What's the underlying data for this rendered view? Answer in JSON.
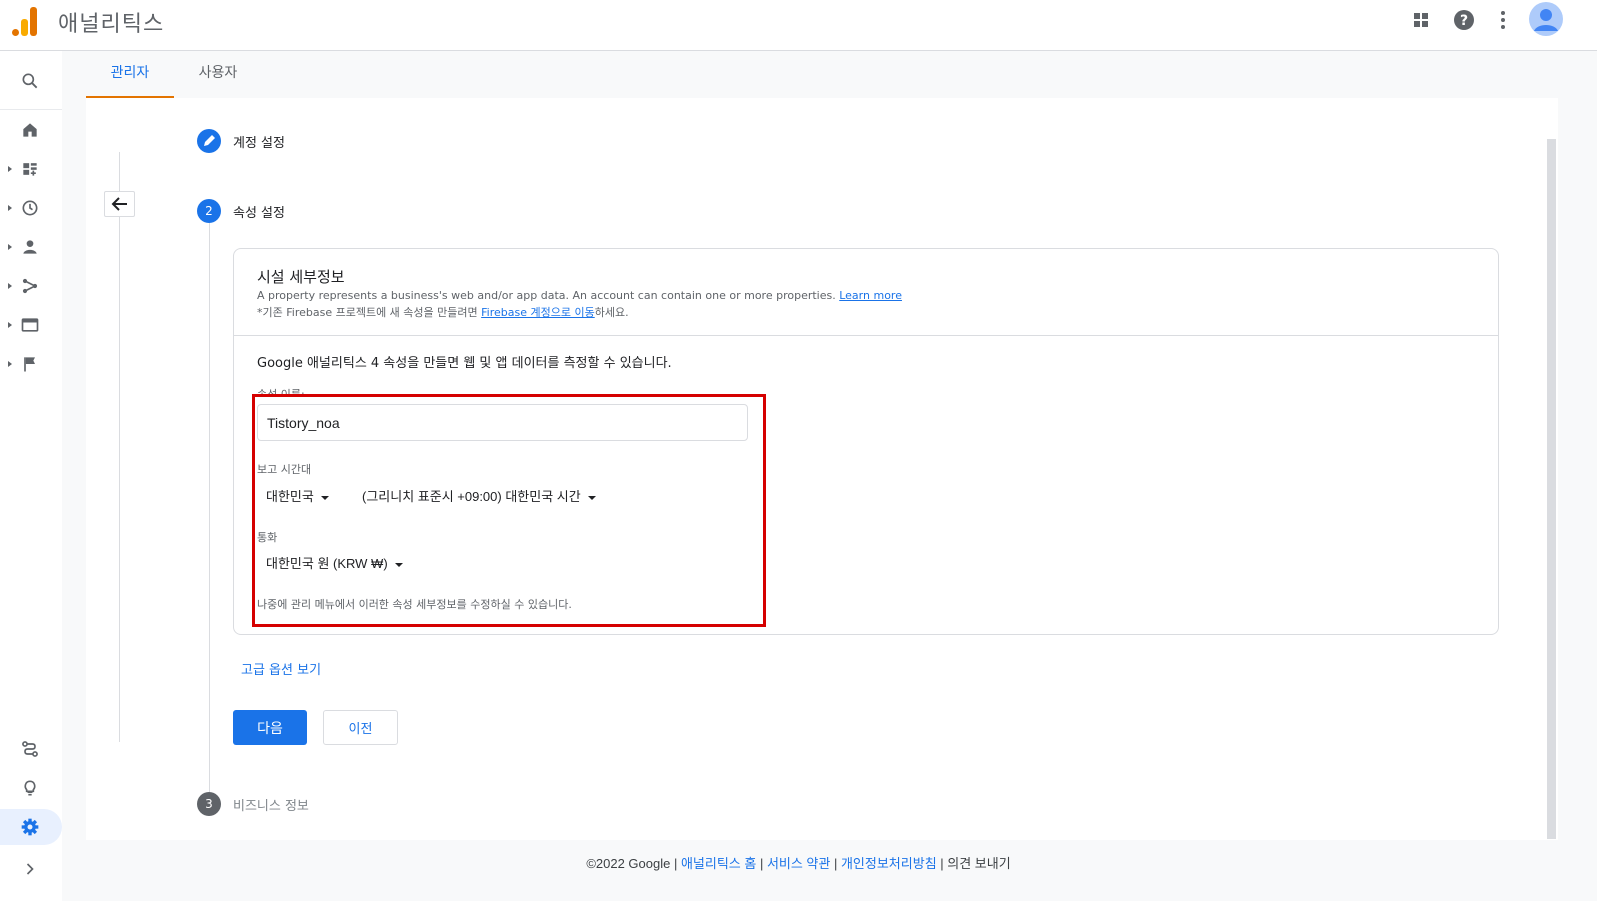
{
  "header": {
    "app_title": "애널리틱스",
    "icons": [
      "apps-grid-icon",
      "help-icon",
      "more-vert-icon",
      "avatar-icon"
    ]
  },
  "nav": {
    "items": [
      "search-icon",
      "home-icon",
      "dashboard-icon",
      "realtime-clock-icon",
      "audience-person-icon",
      "acquisition-icon",
      "behavior-icon",
      "conversions-flag-icon",
      "attribution-icon",
      "insights-lightbulb-icon",
      "admin-gear-icon",
      "expand-chevron-icon"
    ]
  },
  "tabs": [
    {
      "label": "관리자",
      "active": true
    },
    {
      "label": "사용자",
      "active": false
    }
  ],
  "steps": {
    "step1": {
      "label": "계정 설정",
      "state": "done"
    },
    "step2": {
      "number": "2",
      "label": "속성 설정",
      "state": "active"
    },
    "step3": {
      "number": "3",
      "label": "비즈니스 정보",
      "state": "pending"
    }
  },
  "card": {
    "title": "시설 세부정보",
    "desc_text": "A property represents a business's web and/or app data. An account can contain one or more properties.",
    "desc_link": "Learn more",
    "firebase_prefix": "*기존 Firebase 프로젝트에 새 속성을 만들려면 ",
    "firebase_link": "Firebase 계정으로 이동",
    "firebase_suffix": "하세요.",
    "intro": "Google 애널리틱스 4 속성을 만들면 웹 및 앱 데이터를 측정할 수 있습니다."
  },
  "form": {
    "name_label": "속성 이름:",
    "name_value": "Tistory_noa",
    "timezone_label": "보고 시간대",
    "country_value": "대한민국",
    "timezone_value": "(그리니치 표준시 +09:00) 대한민국 시간",
    "currency_label": "통화",
    "currency_value": "대한민국 원 (KRW ₩)",
    "note": "나중에 관리 메뉴에서 이러한 속성 세부정보를 수정하실 수 있습니다."
  },
  "actions": {
    "advanced_link": "고급 옵션 보기",
    "next": "다음",
    "prev": "이전"
  },
  "footer": {
    "copyright": "©2022 Google",
    "home": "애널리틱스 홈",
    "terms": "서비스 약관",
    "privacy": "개인정보처리방침",
    "feedback": "의견 보내기",
    "sep": " | "
  },
  "colors": {
    "brand_orange": "#e37400",
    "accent_blue": "#1a73e8",
    "highlight_red": "#d50000",
    "step_pending": "#5f6368"
  }
}
